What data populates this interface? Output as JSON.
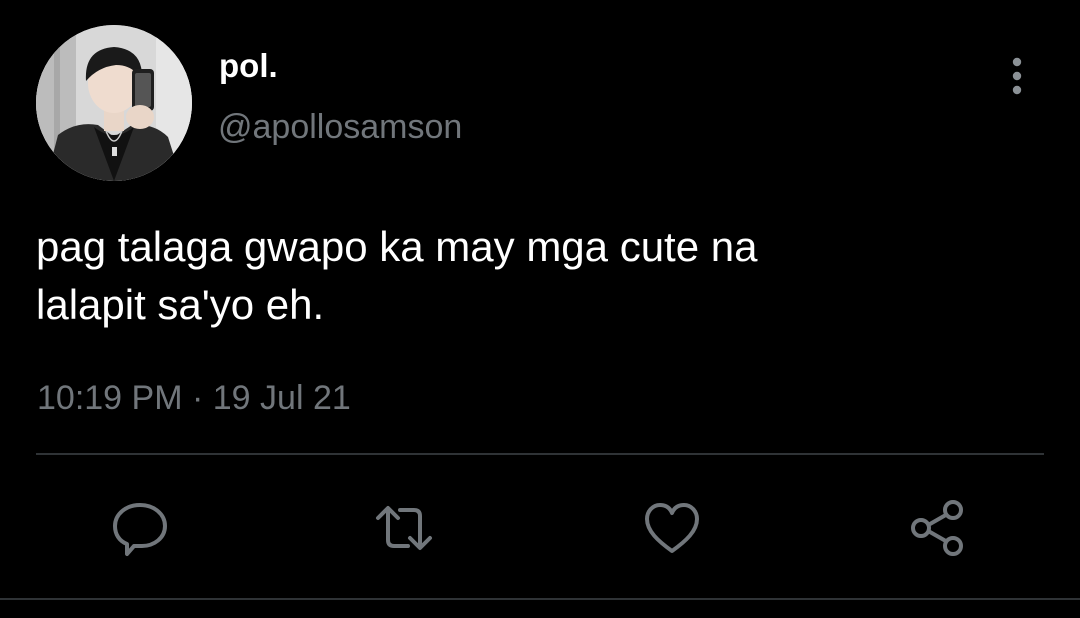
{
  "author": {
    "display_name": "pol.",
    "handle": "@apollosamson"
  },
  "tweet": {
    "text": "pag talaga gwapo ka may mga cute na\nlalapit sa'yo eh.",
    "time": "10:19 PM",
    "separator": "·",
    "date": "19 Jul 21"
  },
  "actions": {
    "reply_icon": "speech-bubble-icon",
    "retweet_icon": "retweet-arrows-icon",
    "like_icon": "heart-icon",
    "share_icon": "share-nodes-icon",
    "more_icon": "vertical-ellipsis-icon"
  },
  "colors": {
    "background": "#000000",
    "primary_text": "#ffffff",
    "secondary_text": "#71767b",
    "divider": "#2f3336",
    "icon": "#71767b"
  }
}
